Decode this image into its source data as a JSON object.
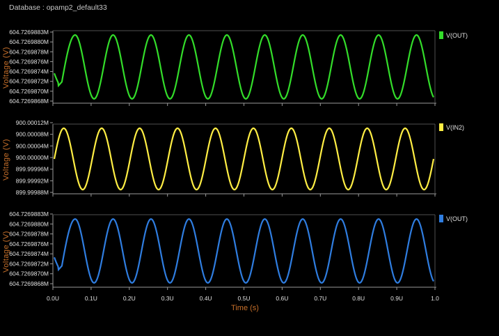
{
  "header": {
    "database_label": "Database : opamp2_default33"
  },
  "colors": {
    "background": "#000000",
    "axis": "#9a9a9a",
    "axis_label": "#c8702a",
    "tick_text": "#e0e0e0",
    "green": "#33dd2a",
    "yellow": "#ffee44",
    "blue": "#2f7de0"
  },
  "chart_data": [
    {
      "type": "line",
      "title": "",
      "xlabel": "Time (s)",
      "ylabel": "Voltage (V)",
      "xlim": [
        0,
        1.0
      ],
      "ylim": [
        604.7269867,
        604.7269884
      ],
      "yticks": [
        "604.7269883M",
        "604.7269880M",
        "604.7269878M",
        "604.7269876M",
        "604.7269874M",
        "604.7269872M",
        "604.7269870M",
        "604.7269868M"
      ],
      "legend": {
        "label": "V(OUT)",
        "color": "#33dd2a",
        "placement": "top-right"
      },
      "series": [
        {
          "name": "V(OUT)",
          "color": "#33dd2a",
          "description_of_shape": "sinusoid, 10 cycles, with initial dip near t=0.01",
          "x": [
            0,
            0.01,
            0.02,
            0.035,
            0.055,
            0.075,
            0.105,
            0.155,
            0.205,
            0.255,
            0.305,
            0.355,
            0.405,
            0.455,
            0.505,
            0.555,
            0.605,
            0.655,
            0.705,
            0.755,
            0.805,
            0.855,
            0.905,
            0.955,
            0.995
          ],
          "values": [
            604.7269874,
            604.7269871,
            604.7269872,
            604.7269879,
            604.7269883,
            604.726988,
            604.7269868,
            604.7269883,
            604.7269868,
            604.7269883,
            604.7269868,
            604.7269883,
            604.7269868,
            604.7269883,
            604.7269868,
            604.7269883,
            604.7269868,
            604.7269883,
            604.7269868,
            604.7269883,
            604.7269868,
            604.7269883,
            604.7269868,
            604.7269883,
            604.7269868
          ]
        }
      ]
    },
    {
      "type": "line",
      "title": "",
      "xlabel": "Time (s)",
      "ylabel": "Voltage (V)",
      "xlim": [
        0,
        1.0
      ],
      "ylim": [
        899.99986,
        900.00013
      ],
      "yticks": [
        "900.00012M",
        "900.00008M",
        "900.00004M",
        "900.00000M",
        "899.99996M",
        "899.99992M",
        "899.99988M"
      ],
      "legend": {
        "label": "V(IN2)",
        "color": "#ffee44",
        "placement": "top-right"
      },
      "series": [
        {
          "name": "V(IN2)",
          "color": "#ffee44",
          "description_of_shape": "sinusoid, 10 cycles, amplitude 0.0001, starts at 900.0",
          "x": [
            0,
            0.025,
            0.075,
            0.125,
            0.175,
            0.225,
            0.275,
            0.325,
            0.375,
            0.425,
            0.475,
            0.525,
            0.575,
            0.625,
            0.675,
            0.725,
            0.775,
            0.825,
            0.875,
            0.925,
            0.975,
            1.0
          ],
          "values": [
            900.0,
            900.0001,
            899.9999,
            900.0001,
            899.9999,
            900.0001,
            899.9999,
            900.0001,
            899.9999,
            900.0001,
            899.9999,
            900.0001,
            899.9999,
            900.0001,
            899.9999,
            900.0001,
            899.9999,
            900.0001,
            899.9999,
            900.0001,
            899.9999,
            900.0
          ]
        }
      ]
    },
    {
      "type": "line",
      "title": "",
      "xlabel": "Time (s)",
      "ylabel": "Voltage (V)",
      "xlim": [
        0,
        1.0
      ],
      "ylim": [
        604.7269867,
        604.7269884
      ],
      "yticks": [
        "604.7269883M",
        "604.7269880M",
        "604.7269878M",
        "604.7269876M",
        "604.7269874M",
        "604.7269872M",
        "604.7269870M",
        "604.7269868M"
      ],
      "xticks": [
        "0.0U",
        "0.1U",
        "0.2U",
        "0.3U",
        "0.4U",
        "0.5U",
        "0.6U",
        "0.7U",
        "0.8U",
        "0.9U",
        "1.0"
      ],
      "legend": {
        "label": "V(OUT)",
        "color": "#2f7de0",
        "placement": "top-right"
      },
      "series": [
        {
          "name": "V(OUT)",
          "color": "#2f7de0",
          "description_of_shape": "sinusoid, 10 cycles, with initial dip near t=0.01",
          "x": [
            0,
            0.01,
            0.02,
            0.035,
            0.055,
            0.075,
            0.105,
            0.155,
            0.205,
            0.255,
            0.305,
            0.355,
            0.405,
            0.455,
            0.505,
            0.555,
            0.605,
            0.655,
            0.705,
            0.755,
            0.805,
            0.855,
            0.905,
            0.955,
            0.995
          ],
          "values": [
            604.7269874,
            604.7269871,
            604.7269872,
            604.7269879,
            604.7269883,
            604.726988,
            604.7269868,
            604.7269883,
            604.7269868,
            604.7269883,
            604.7269868,
            604.7269883,
            604.7269868,
            604.7269883,
            604.7269868,
            604.7269883,
            604.7269868,
            604.7269883,
            604.7269868,
            604.7269883,
            604.7269868,
            604.7269883,
            604.7269868,
            604.7269883,
            604.7269868
          ]
        }
      ]
    }
  ]
}
